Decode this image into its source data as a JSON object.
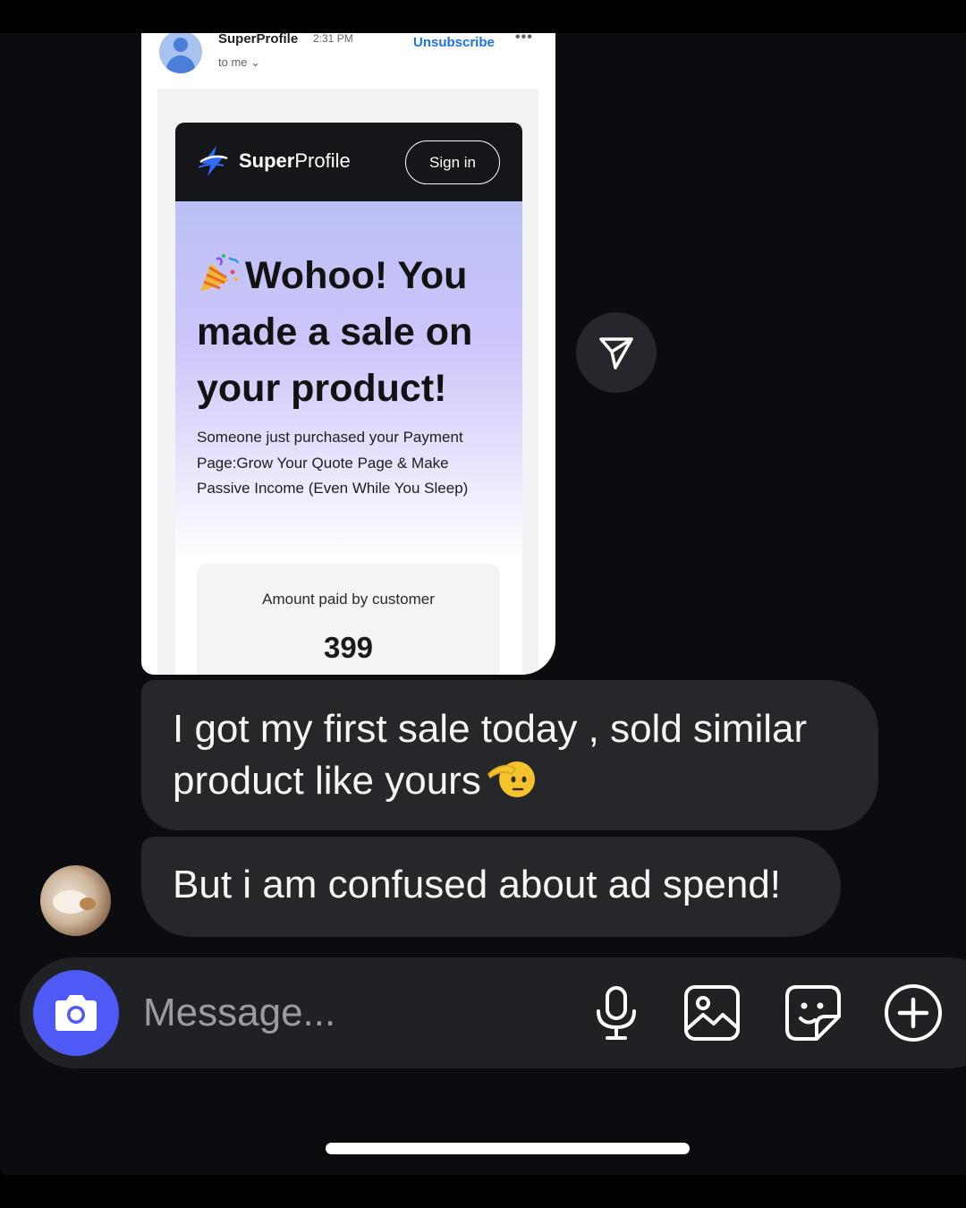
{
  "email": {
    "sender": "SuperProfile",
    "time": "2:31 PM",
    "recipient": "to me ⌄",
    "unsubscribe": "Unsubscribe",
    "more": "•••"
  },
  "superprofile": {
    "brand_bold": "Super",
    "brand_regular": "Profile",
    "sign_in": "Sign in",
    "headline": "Wohoo! You made a sale on your product!",
    "description": "Someone just purchased your Payment Page:Grow Your Quote Page & Make Passive Income (Even While You Sleep)",
    "amount_label": "Amount paid by customer",
    "amount_value": "399"
  },
  "messages": [
    {
      "text": "I got my first sale today , sold similar product like yours",
      "emoji": "saluting-face-icon"
    },
    {
      "text": "But i am confused about ad spend!"
    }
  ],
  "composer": {
    "placeholder": "Message...",
    "icons": [
      "camera-icon",
      "microphone-icon",
      "gallery-icon",
      "sticker-icon",
      "plus-icon"
    ]
  },
  "colors": {
    "accent": "#4f59f5",
    "bubble": "#25272b",
    "background": "#0b0c0f",
    "link": "#1a73e8"
  }
}
